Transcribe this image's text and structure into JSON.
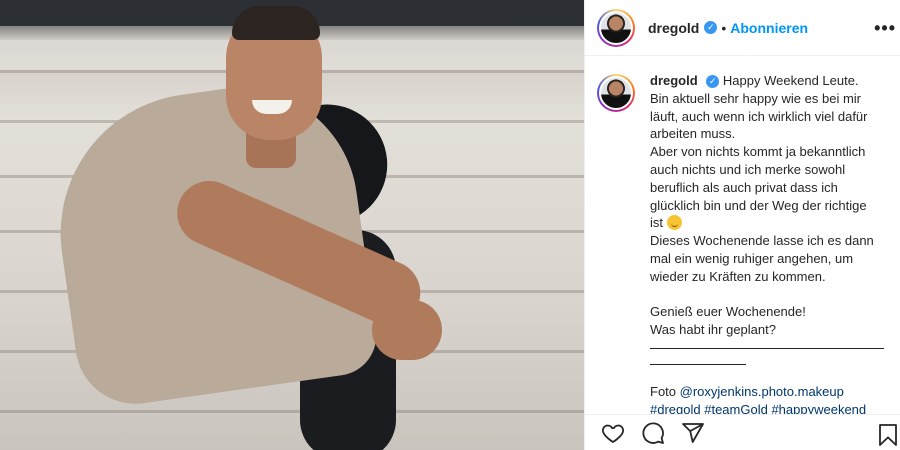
{
  "post": {
    "username": "dregold",
    "verified_glyph": "✓",
    "separator": "•",
    "follow_label": "Abonnieren",
    "more_label": "•••"
  },
  "caption": {
    "username": "dregold",
    "lines_a": [
      "Happy Weekend Leute.",
      "Bin aktuell sehr happy wie es bei mir",
      "läuft, auch wenn ich wirklich viel dafür",
      "arbeiten muss.",
      "Aber von nichts kommt ja bekanntlich",
      "auch nichts und ich merke sowohl",
      "beruflich als auch privat dass ich",
      "glücklich bin und der Weg der richtige",
      "ist"
    ],
    "lines_b": [
      "Dieses Wochenende lasse ich es dann",
      "mal ein wenig ruhiger angehen, um",
      "wieder zu Kräften zu kommen."
    ],
    "lines_c": [
      "Genieß euer Wochenende!",
      "Was habt ihr geplant?"
    ],
    "photo_credit_prefix": "Foto",
    "photo_credit_handle": "@roxyjenkins.photo.makeup",
    "hashtags": [
      "#dregold",
      "#teamGold",
      "#happyweekend"
    ]
  },
  "icons": {
    "like": "heart-icon",
    "comment": "comment-icon",
    "share": "share-icon",
    "save": "bookmark-icon",
    "emoji": "hugging-face-emoji"
  },
  "colors": {
    "link": "#0095f6",
    "hashtag": "#00376b",
    "verified": "#3897f0",
    "text": "#262626"
  }
}
